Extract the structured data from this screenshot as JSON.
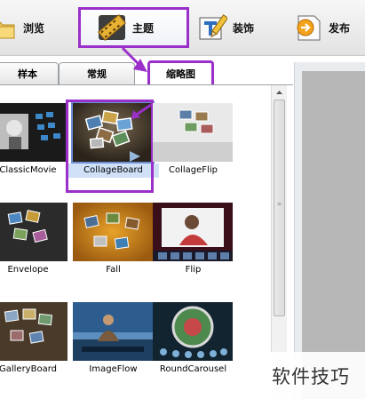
{
  "toolbar": {
    "items": [
      {
        "label": "浏览",
        "icon": "folder-icon"
      },
      {
        "label": "主题",
        "icon": "film-strip-icon",
        "active": true
      },
      {
        "label": "装饰",
        "icon": "pencil-paper-icon"
      },
      {
        "label": "发布",
        "icon": "publish-arrow-icon"
      }
    ]
  },
  "tabs": {
    "items": [
      {
        "label": "样本"
      },
      {
        "label": "常规"
      },
      {
        "label": "缩略图",
        "active": true
      }
    ]
  },
  "themes": [
    {
      "name": "ClassicMovie"
    },
    {
      "name": "CollageBoard",
      "selected": true
    },
    {
      "name": "CollageFlip"
    },
    {
      "name": "Envelope"
    },
    {
      "name": "Fall"
    },
    {
      "name": "Flip"
    },
    {
      "name": "GalleryBoard"
    },
    {
      "name": "ImageFlow"
    },
    {
      "name": "RoundCarousel"
    }
  ],
  "watermark": {
    "text": "软件技巧"
  },
  "colors": {
    "highlight": "#9b2fc9",
    "selection": "#cfe0f7"
  }
}
